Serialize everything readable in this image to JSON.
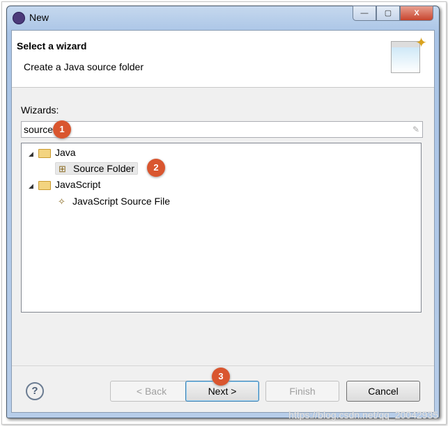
{
  "window": {
    "title": "New",
    "min": "—",
    "max": "▢",
    "close": "X"
  },
  "header": {
    "title": "Select a wizard",
    "description": "Create a Java source folder"
  },
  "wizards_label": "Wizards:",
  "search": {
    "value": "source",
    "clear_icon": "✎"
  },
  "tree": [
    {
      "label": "Java",
      "type": "folder",
      "expanded": true
    },
    {
      "label": "Source Folder",
      "type": "item",
      "selected": true
    },
    {
      "label": "JavaScript",
      "type": "folder",
      "expanded": true
    },
    {
      "label": "JavaScript Source File",
      "type": "item"
    }
  ],
  "badges": [
    "1",
    "2",
    "3"
  ],
  "buttons": {
    "help": "?",
    "back": "< Back",
    "next": "Next >",
    "finish": "Finish",
    "cancel": "Cancel"
  },
  "watermark": "https://blog.csdn.net/qq_20042935",
  "colors": {
    "badge": "#d9562f",
    "default_button_border": "#3c7fb1"
  }
}
